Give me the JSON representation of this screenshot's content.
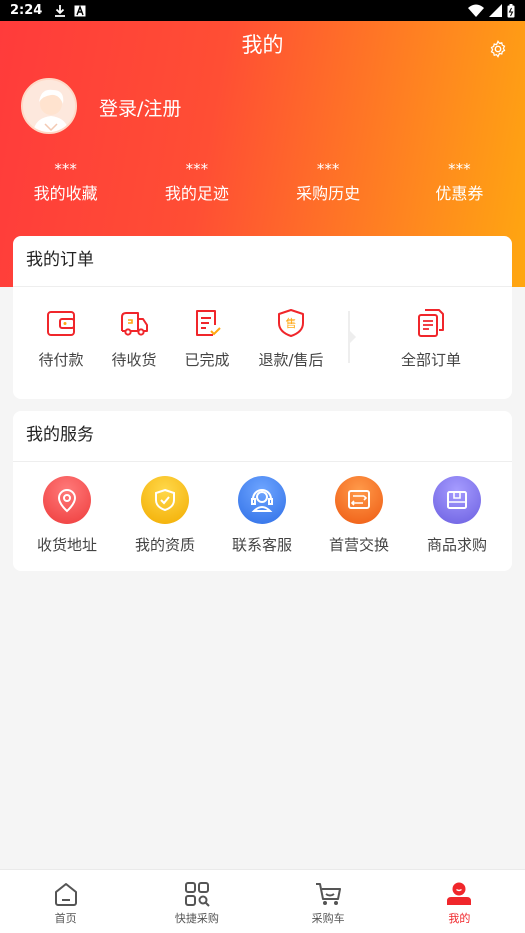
{
  "status_bar": {
    "time": "2:24"
  },
  "header": {
    "title": "我的",
    "login_label": "登录/注册"
  },
  "stats": [
    {
      "value": "***",
      "label": "我的收藏"
    },
    {
      "value": "***",
      "label": "我的足迹"
    },
    {
      "value": "***",
      "label": "采购历史"
    },
    {
      "value": "***",
      "label": "优惠券"
    }
  ],
  "orders": {
    "title": "我的订单",
    "items": [
      {
        "label": "待付款",
        "icon": "wallet-icon"
      },
      {
        "label": "待收货",
        "icon": "truck-icon"
      },
      {
        "label": "已完成",
        "icon": "checklist-icon"
      },
      {
        "label": "退款/售后",
        "icon": "shield-sale-icon"
      },
      {
        "label": "全部订单",
        "icon": "documents-icon"
      }
    ]
  },
  "services": {
    "title": "我的服务",
    "items": [
      {
        "label": "收货地址",
        "icon": "location-icon",
        "color": "#f04848"
      },
      {
        "label": "我的资质",
        "icon": "shield-check-icon",
        "color": "#f5b400"
      },
      {
        "label": "联系客服",
        "icon": "customer-service-icon",
        "color": "#3d7ff0"
      },
      {
        "label": "首营交换",
        "icon": "exchange-icon",
        "color": "#f2641c"
      },
      {
        "label": "商品求购",
        "icon": "box-icon",
        "color": "#7b6fe8"
      }
    ]
  },
  "tabbar": [
    {
      "label": "首页",
      "icon": "home-icon",
      "active": false
    },
    {
      "label": "快捷采购",
      "icon": "grid-search-icon",
      "active": false
    },
    {
      "label": "采购车",
      "icon": "cart-icon",
      "active": false
    },
    {
      "label": "我的",
      "icon": "profile-icon",
      "active": true
    }
  ],
  "colors": {
    "brand_red": "#f0262b",
    "gradient_start": "#ff3b3b",
    "gradient_end": "#ffa710"
  }
}
